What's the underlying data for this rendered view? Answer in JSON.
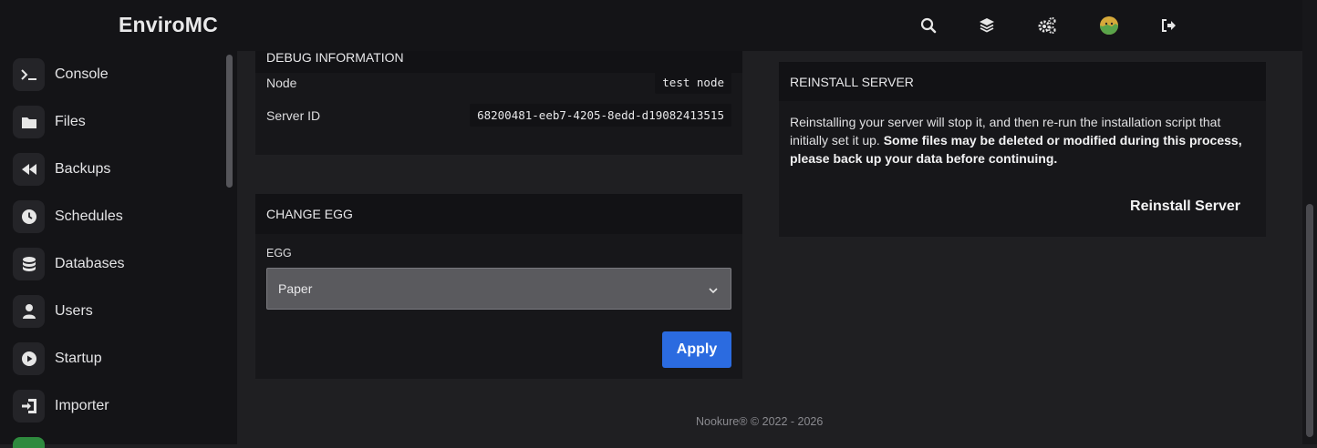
{
  "header": {
    "brand": "EnviroMC",
    "icons": [
      "search-icon",
      "layers-icon",
      "cogs-icon",
      "avatar",
      "logout-icon"
    ]
  },
  "sidebar": {
    "items": [
      {
        "label": "Console",
        "icon": "terminal-icon"
      },
      {
        "label": "Files",
        "icon": "folder-icon"
      },
      {
        "label": "Backups",
        "icon": "backward-icon"
      },
      {
        "label": "Schedules",
        "icon": "clock-icon"
      },
      {
        "label": "Databases",
        "icon": "database-icon"
      },
      {
        "label": "Users",
        "icon": "user-icon"
      },
      {
        "label": "Startup",
        "icon": "play-icon"
      },
      {
        "label": "Importer",
        "icon": "import-icon"
      }
    ]
  },
  "debug": {
    "title": "DEBUG INFORMATION",
    "node_label": "Node",
    "node_value": "test node",
    "server_id_label": "Server ID",
    "server_id_value": "68200481-eeb7-4205-8edd-d19082413515"
  },
  "change_egg": {
    "title": "CHANGE EGG",
    "field_label": "EGG",
    "selected": "Paper",
    "apply_label": "Apply"
  },
  "reinstall": {
    "title": "REINSTALL SERVER",
    "text_normal": "Reinstalling your server will stop it, and then re-run the installation script that initially set it up.",
    "text_bold": "Some files may be deleted or modified during this process, please back up your data before continuing.",
    "button_label": "Reinstall Server"
  },
  "footer": {
    "text": "Nookure® © 2022 - 2026"
  },
  "colors": {
    "accent": "#2b6be0",
    "background": "#1f1f22",
    "panel": "#17171a"
  }
}
